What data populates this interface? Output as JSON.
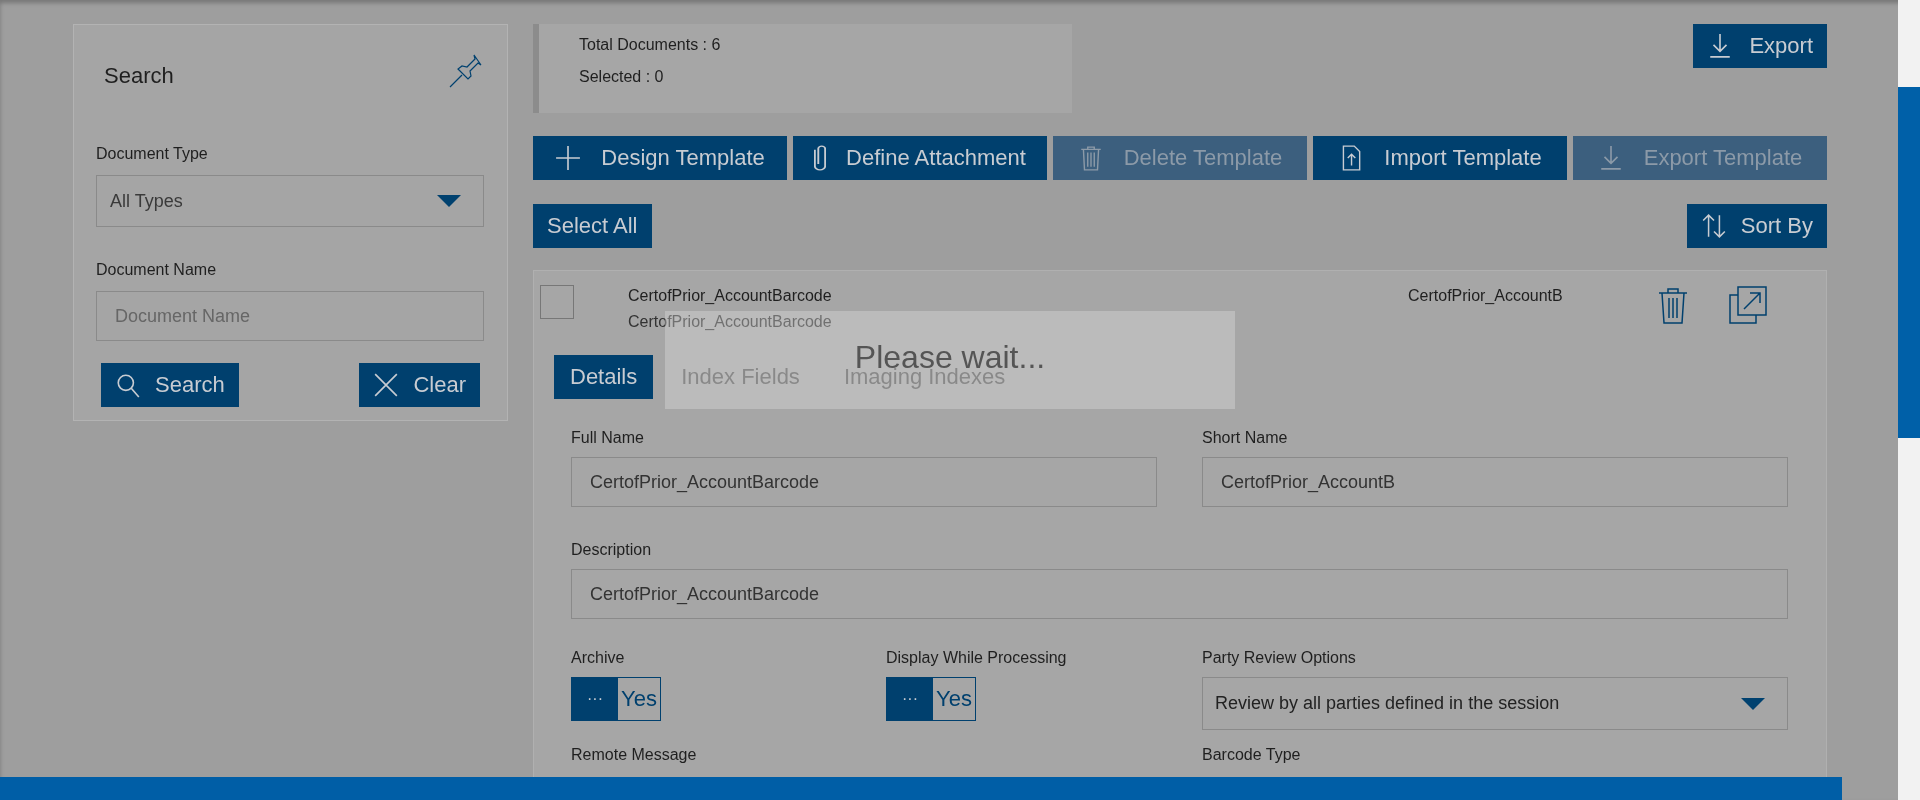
{
  "search_panel": {
    "title": "Search",
    "document_type": {
      "label": "Document Type",
      "value": "All Types"
    },
    "document_name": {
      "label": "Document Name",
      "placeholder": "Document Name"
    },
    "buttons": [
      {
        "kind": "search",
        "label": "Search"
      },
      {
        "kind": "clear",
        "label": "Clear"
      }
    ]
  },
  "summary": {
    "total_label": "Total Documents :",
    "total": "6",
    "selected_label": "Selected :",
    "selected": "0"
  },
  "export_button": "Export",
  "template_buttons": [
    {
      "kind": "plus",
      "label": "Design Template",
      "disabled": false
    },
    {
      "kind": "clip",
      "label": "Define Attachment",
      "disabled": false
    },
    {
      "kind": "trash",
      "label": "Delete Template",
      "disabled": true
    },
    {
      "kind": "import",
      "label": "Import Template",
      "disabled": false
    },
    {
      "kind": "export",
      "label": "Export Template",
      "disabled": true
    }
  ],
  "select_all": "Select All",
  "sort_by": "Sort By",
  "document": {
    "checked": false,
    "full_name": "CertofPrior_AccountBarcode",
    "description": "CertofPrior_AccountBarcode",
    "short_name": "CertofPrior_AccountB",
    "tabs": [
      {
        "label": "Details",
        "selected": true
      },
      {
        "label": "Index Fields",
        "selected": false
      },
      {
        "label": "Imaging Indexes",
        "selected": false
      }
    ],
    "fields": {
      "full_name": {
        "label": "Full Name",
        "value": "CertofPrior_AccountBarcode"
      },
      "short_name": {
        "label": "Short Name",
        "value": "CertofPrior_AccountB"
      },
      "description": {
        "label": "Description",
        "value": "CertofPrior_AccountBarcode"
      }
    },
    "toggles": [
      {
        "label": "Archive",
        "on": true,
        "handle": "···",
        "text": "Yes"
      },
      {
        "label": "Display While Processing",
        "on": true,
        "handle": "···",
        "text": "Yes"
      }
    ],
    "party_review": {
      "label": "Party Review Options",
      "value": "Review by all parties defined in the session"
    },
    "next_labels": [
      "Remote Message",
      "Barcode Type"
    ]
  },
  "loading": {
    "message": "Please wait..."
  }
}
